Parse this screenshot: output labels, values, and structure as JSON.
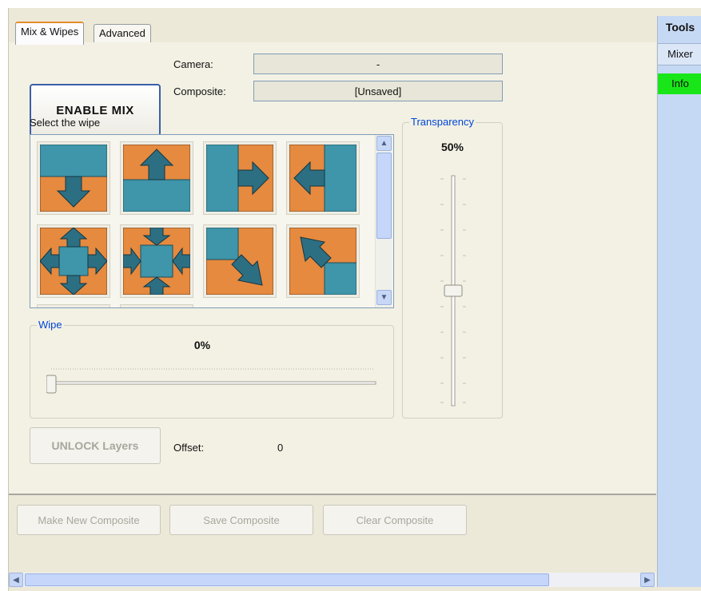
{
  "tabs": [
    {
      "label": "Mix & Wipes",
      "active": true
    },
    {
      "label": "Advanced",
      "active": false
    }
  ],
  "enable_mix_label": "ENABLE MIX",
  "camera": {
    "label": "Camera:",
    "value": "-"
  },
  "composite": {
    "label": "Composite:",
    "value": "[Unsaved]"
  },
  "select_wipe_label": "Select the wipe",
  "wipes": [
    {
      "icon": "wipe-down-icon"
    },
    {
      "icon": "wipe-up-icon"
    },
    {
      "icon": "wipe-right-icon"
    },
    {
      "icon": "wipe-left-icon"
    },
    {
      "icon": "wipe-expand-icon"
    },
    {
      "icon": "wipe-contract-icon"
    },
    {
      "icon": "wipe-diagonal-down-right-icon"
    },
    {
      "icon": "wipe-diagonal-up-left-icon"
    }
  ],
  "transparency": {
    "title": "Transparency",
    "value_text": "50%",
    "value": 0.5
  },
  "wipe": {
    "title": "Wipe",
    "value_text": "0%",
    "value": 0
  },
  "unlock_layers_label": "UNLOCK Layers",
  "offset": {
    "label": "Offset:",
    "value": "0"
  },
  "buttons": {
    "make_new": "Make New Composite",
    "save": "Save Composite",
    "clear": "Clear Composite"
  },
  "sidebar": {
    "title": "Tools",
    "items": [
      {
        "label": "Mixer",
        "active": false
      },
      {
        "label": "Info",
        "active": true
      }
    ]
  },
  "colors": {
    "orange": "#e58a3f",
    "teal": "#3f95a9",
    "info_green": "#19e619",
    "accent_blue": "#0046d5"
  }
}
